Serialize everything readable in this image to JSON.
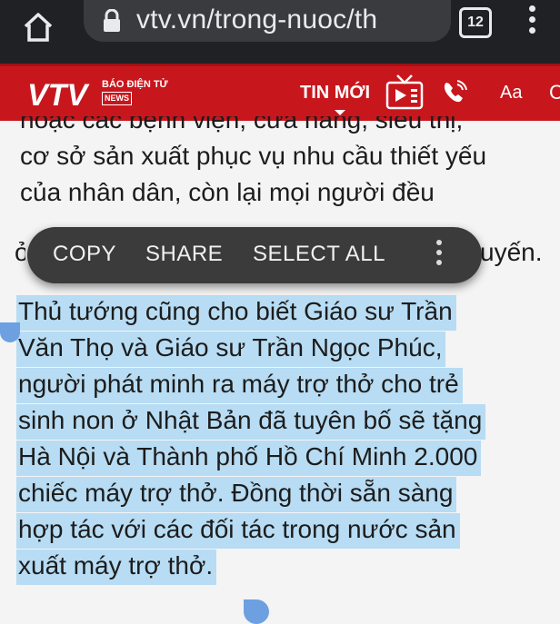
{
  "browser": {
    "url": "vtv.vn/trong-nuoc/th",
    "tab_count": "12"
  },
  "site": {
    "logo_main": "VTV",
    "logo_sub": "BÁO ĐIỆN TỬ",
    "logo_news": "NEWS",
    "nav_label": "TIN MỚI",
    "font_label": "Aa",
    "overflow_label": "C"
  },
  "article": {
    "partial_line": "hoặc các bệnh viện, cửa hàng, siêu thị,",
    "lines": [
      "cơ sở sản xuất phục vụ nhu cầu thiết yếu",
      "của nhân dân, còn lại mọi người đều"
    ],
    "hidden_line_start": "ở",
    "hidden_line_end": "uyến.",
    "selected_lines": [
      "Thủ tướng cũng cho biết Giáo sư Trần",
      "Văn Thọ và Giáo sư Trần Ngọc Phúc,",
      "người phát minh ra máy trợ thở cho trẻ",
      "sinh non ở Nhật Bản đã tuyên bố sẽ tặng",
      "Hà Nội và Thành phố Hồ Chí Minh 2.000",
      "chiếc máy trợ thở. Đồng thời sẵn sàng",
      "hợp tác với các đối tác trong nước sản",
      "xuất máy trợ thở."
    ]
  },
  "context_menu": {
    "copy": "COPY",
    "share": "SHARE",
    "select_all": "SELECT ALL"
  }
}
